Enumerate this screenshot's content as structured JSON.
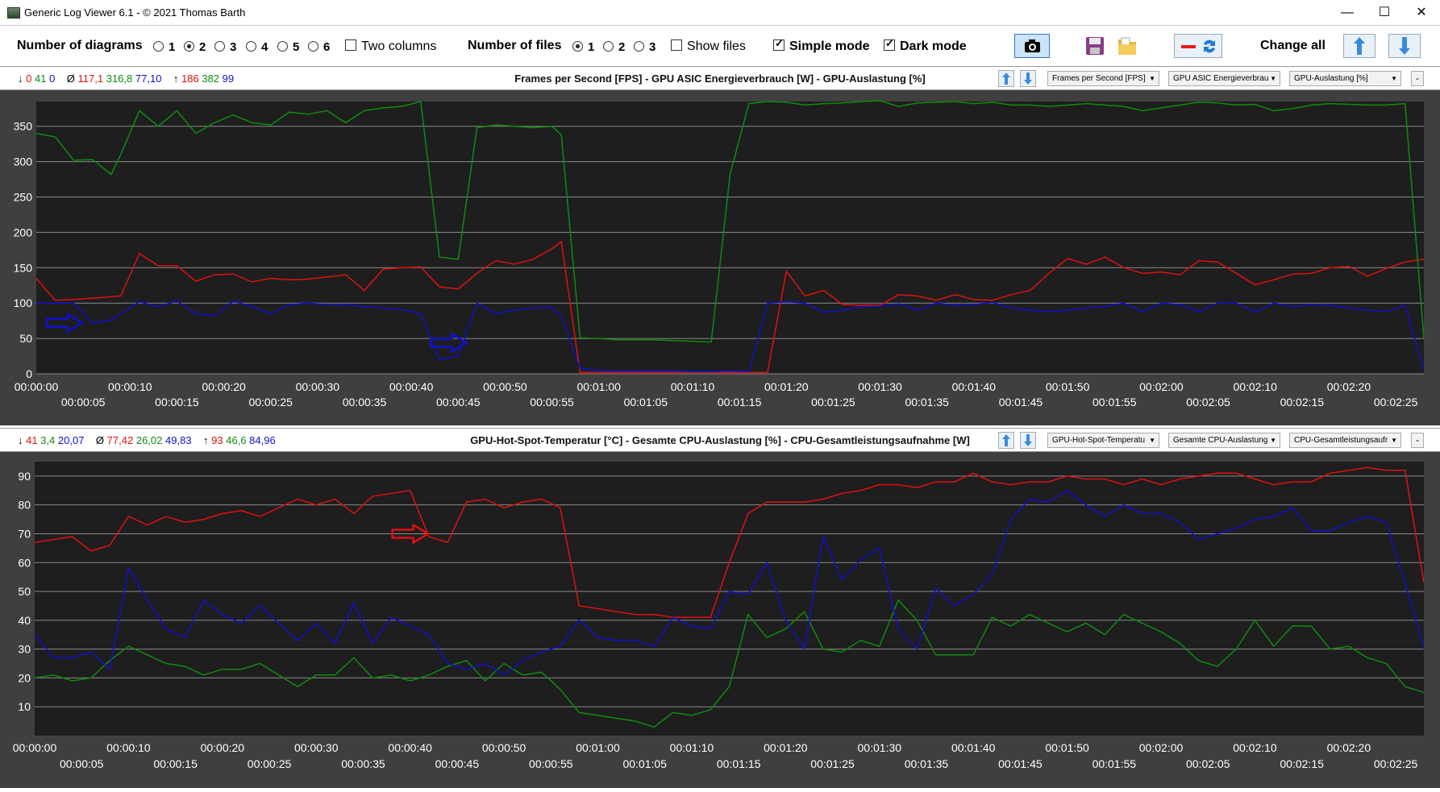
{
  "window": {
    "title": "Generic Log Viewer 6.1 - © 2021 Thomas Barth",
    "minimize": "—",
    "maximize": "☐",
    "close": "✕"
  },
  "toolbar": {
    "num_diagrams_label": "Number of diagrams",
    "diagram_options": [
      "1",
      "2",
      "3",
      "4",
      "5",
      "6"
    ],
    "diagram_selected": "2",
    "two_columns_label": "Two columns",
    "two_columns_checked": false,
    "num_files_label": "Number of files",
    "file_options": [
      "1",
      "2",
      "3"
    ],
    "file_selected": "1",
    "show_files_label": "Show files",
    "show_files_checked": false,
    "simple_mode_label": "Simple mode",
    "simple_mode_checked": true,
    "dark_mode_label": "Dark mode",
    "dark_mode_checked": true,
    "change_all_label": "Change all",
    "icons": [
      "camera-icon",
      "save-icon",
      "folder-icon",
      "remove-refresh-icon",
      "arrow-up-icon",
      "arrow-down-icon"
    ]
  },
  "colors": {
    "red": "#e01010",
    "green": "#108a10",
    "blue": "#1010d0",
    "chart_bg": "#1e1e1e",
    "panel_bg": "#3f3f3f",
    "grid": "#8a8a8a"
  },
  "panels": [
    {
      "stats": {
        "min_prefix": "↓",
        "min": [
          "0",
          "41",
          "0"
        ],
        "avg_prefix": "Ø",
        "avg": [
          "117,1",
          "316,8",
          "77,10"
        ],
        "max_prefix": "↑",
        "max": [
          "186",
          "382",
          "99"
        ]
      },
      "title": "Frames per Second [FPS]  -  GPU ASIC Energieverbrauch [W]  -  GPU-Auslastung [%]",
      "selectors": [
        "Frames per Second [FPS]",
        "GPU ASIC Energieverbrau",
        "GPU-Auslastung [%]"
      ],
      "minus": "-"
    },
    {
      "stats": {
        "min_prefix": "↓",
        "min": [
          "41",
          "3,4",
          "20,07"
        ],
        "avg_prefix": "Ø",
        "avg": [
          "77,42",
          "26,02",
          "49,83"
        ],
        "max_prefix": "↑",
        "max": [
          "93",
          "46,6",
          "84,96"
        ]
      },
      "title": "GPU-Hot-Spot-Temperatur [°C]  -  Gesamte CPU-Auslastung [%]  -  CPU-Gesamtleistungsaufnahme [W]",
      "selectors": [
        "GPU-Hot-Spot-Temperatu",
        "Gesamte CPU-Auslastung",
        "CPU-Gesamtleistungsaufr"
      ],
      "minus": "-"
    }
  ],
  "chart_data": [
    {
      "type": "line",
      "ylim": [
        0,
        385
      ],
      "yticks": [
        "0",
        "50",
        "100",
        "150",
        "200",
        "250",
        "300",
        "350"
      ],
      "xlim": [
        0,
        148
      ],
      "xticks_top": [
        "00:00:00",
        "00:00:10",
        "00:00:20",
        "00:00:30",
        "00:00:40",
        "00:00:50",
        "00:01:00",
        "00:01:10",
        "00:01:20",
        "00:01:30",
        "00:01:40",
        "00:01:50",
        "00:02:00",
        "00:02:10",
        "00:02:20"
      ],
      "xticks_bottom": [
        "00:00:05",
        "00:00:15",
        "00:00:25",
        "00:00:35",
        "00:00:45",
        "00:00:55",
        "00:01:05",
        "00:01:15",
        "00:01:25",
        "00:01:35",
        "00:01:45",
        "00:01:55",
        "00:02:05",
        "00:02:15",
        "00:02:25"
      ],
      "x": [
        0,
        2,
        4,
        6,
        8,
        9,
        11,
        13,
        15,
        17,
        19,
        21,
        23,
        25,
        27,
        29,
        31,
        33,
        35,
        37,
        39,
        41,
        43,
        45,
        47,
        49,
        51,
        53,
        55,
        56,
        58,
        60,
        62,
        64,
        66,
        68,
        70,
        72,
        74,
        76,
        78,
        80,
        82,
        84,
        86,
        88,
        90,
        92,
        94,
        96,
        98,
        100,
        102,
        104,
        106,
        108,
        110,
        112,
        114,
        116,
        118,
        120,
        122,
        124,
        126,
        128,
        130,
        132,
        134,
        136,
        138,
        140,
        142,
        144,
        146,
        148
      ],
      "series": [
        {
          "color": "red",
          "values": [
            135,
            104,
            105,
            107,
            109,
            110,
            170,
            153,
            153,
            131,
            140,
            141,
            130,
            135,
            133,
            134,
            137,
            140,
            118,
            148,
            150,
            151,
            123,
            120,
            142,
            160,
            155,
            162,
            177,
            187,
            2,
            2,
            2,
            2,
            2,
            2,
            2,
            2,
            2,
            2,
            2,
            145,
            110,
            118,
            98,
            97,
            97,
            112,
            110,
            104,
            112,
            105,
            104,
            112,
            118,
            142,
            163,
            155,
            165,
            150,
            142,
            144,
            140,
            160,
            158,
            142,
            126,
            133,
            141,
            142,
            150,
            152,
            138,
            149,
            158,
            162
          ]
        },
        {
          "color": "green",
          "values": [
            340,
            335,
            302,
            303,
            282,
            310,
            372,
            350,
            372,
            340,
            355,
            366,
            355,
            352,
            370,
            367,
            372,
            355,
            372,
            376,
            378,
            385,
            165,
            162,
            348,
            352,
            350,
            348,
            350,
            338,
            51,
            50,
            48,
            48,
            48,
            47,
            46,
            45,
            282,
            382,
            385,
            384,
            380,
            382,
            383,
            385,
            386,
            378,
            383,
            384,
            385,
            382,
            384,
            380,
            380,
            378,
            380,
            382,
            380,
            378,
            372,
            376,
            380,
            384,
            383,
            380,
            381,
            372,
            375,
            380,
            382,
            381,
            380,
            380,
            382,
            50
          ]
        },
        {
          "color": "blue",
          "values": [
            100,
            100,
            100,
            72,
            76,
            85,
            102,
            95,
            103,
            85,
            82,
            103,
            95,
            85,
            98,
            100,
            98,
            98,
            95,
            93,
            91,
            85,
            20,
            25,
            100,
            85,
            90,
            93,
            94,
            82,
            8,
            5,
            4,
            4,
            5,
            4,
            3,
            3,
            4,
            3,
            100,
            102,
            100,
            87,
            90,
            95,
            96,
            99,
            90,
            100,
            97,
            98,
            101,
            93,
            90,
            88,
            90,
            93,
            95,
            100,
            88,
            100,
            98,
            88,
            100,
            100,
            87,
            100,
            95,
            98,
            97,
            93,
            90,
            88,
            97,
            5
          ]
        }
      ]
    },
    {
      "type": "line",
      "ylim": [
        0,
        95
      ],
      "yticks": [
        "10",
        "20",
        "30",
        "40",
        "50",
        "60",
        "70",
        "80",
        "90"
      ],
      "xlim": [
        0,
        148
      ],
      "xticks_top": [
        "00:00:00",
        "00:00:10",
        "00:00:20",
        "00:00:30",
        "00:00:40",
        "00:00:50",
        "00:01:00",
        "00:01:10",
        "00:01:20",
        "00:01:30",
        "00:01:40",
        "00:01:50",
        "00:02:00",
        "00:02:10",
        "00:02:20"
      ],
      "xticks_bottom": [
        "00:00:05",
        "00:00:15",
        "00:00:25",
        "00:00:35",
        "00:00:45",
        "00:00:55",
        "00:01:05",
        "00:01:15",
        "00:01:25",
        "00:01:35",
        "00:01:45",
        "00:01:55",
        "00:02:05",
        "00:02:15",
        "00:02:25"
      ],
      "x": [
        0,
        2,
        4,
        6,
        8,
        10,
        12,
        14,
        16,
        18,
        20,
        22,
        24,
        26,
        28,
        30,
        32,
        34,
        36,
        38,
        40,
        42,
        44,
        46,
        48,
        50,
        52,
        54,
        56,
        58,
        60,
        62,
        64,
        66,
        68,
        70,
        72,
        74,
        76,
        78,
        80,
        82,
        84,
        86,
        88,
        90,
        92,
        94,
        96,
        98,
        100,
        102,
        104,
        106,
        108,
        110,
        112,
        114,
        116,
        118,
        120,
        122,
        124,
        126,
        128,
        130,
        132,
        134,
        136,
        138,
        140,
        142,
        144,
        146,
        148
      ],
      "series": [
        {
          "color": "red",
          "values": [
            67,
            68,
            69,
            64,
            66,
            76,
            73,
            76,
            74,
            75,
            77,
            78,
            76,
            79,
            82,
            80,
            82,
            77,
            83,
            84,
            85,
            69,
            67,
            81,
            82,
            79,
            81,
            82,
            79,
            45,
            44,
            43,
            42,
            42,
            41,
            41,
            41,
            60,
            77,
            81,
            81,
            81,
            82,
            84,
            85,
            87,
            87,
            86,
            88,
            88,
            91,
            88,
            87,
            88,
            88,
            90,
            89,
            89,
            87,
            89,
            87,
            89,
            90,
            91,
            91,
            89,
            87,
            88,
            88,
            91,
            92,
            93,
            92,
            92,
            53
          ]
        },
        {
          "color": "green",
          "values": [
            20,
            21,
            19,
            20,
            26,
            31,
            28,
            25,
            24,
            21,
            23,
            23,
            25,
            21,
            17,
            21,
            21,
            27,
            20,
            21,
            19,
            21,
            24,
            26,
            19,
            25,
            21,
            22,
            16,
            8,
            7,
            6,
            5,
            3,
            8,
            7,
            9,
            17,
            42,
            34,
            37,
            43,
            30,
            29,
            33,
            31,
            47,
            40,
            28,
            28,
            28,
            41,
            38,
            42,
            39,
            36,
            39,
            35,
            42,
            39,
            36,
            32,
            26,
            24,
            30,
            40,
            31,
            38,
            38,
            30,
            31,
            27,
            25,
            17,
            15
          ]
        },
        {
          "color": "blue",
          "values": [
            35,
            27,
            27,
            29,
            23,
            58,
            47,
            37,
            34,
            47,
            42,
            39,
            45,
            39,
            33,
            39,
            32,
            46,
            32,
            41,
            38,
            35,
            25,
            23,
            25,
            21,
            26,
            29,
            31,
            40,
            34,
            33,
            33,
            31,
            41,
            38,
            37,
            50,
            49,
            60,
            40,
            30,
            69,
            54,
            61,
            65,
            37,
            30,
            51,
            45,
            49,
            56,
            75,
            82,
            81,
            85,
            80,
            76,
            80,
            77,
            77,
            74,
            68,
            70,
            72,
            75,
            76,
            79,
            71,
            71,
            74,
            76,
            74,
            53,
            30
          ]
        }
      ]
    }
  ],
  "annotations": [
    {
      "panel": 0,
      "color": "blue",
      "x": 3,
      "y": 72
    },
    {
      "panel": 0,
      "color": "blue",
      "x": 44,
      "y": 44
    },
    {
      "panel": 1,
      "color": "red",
      "x": 40,
      "y": 70
    }
  ]
}
